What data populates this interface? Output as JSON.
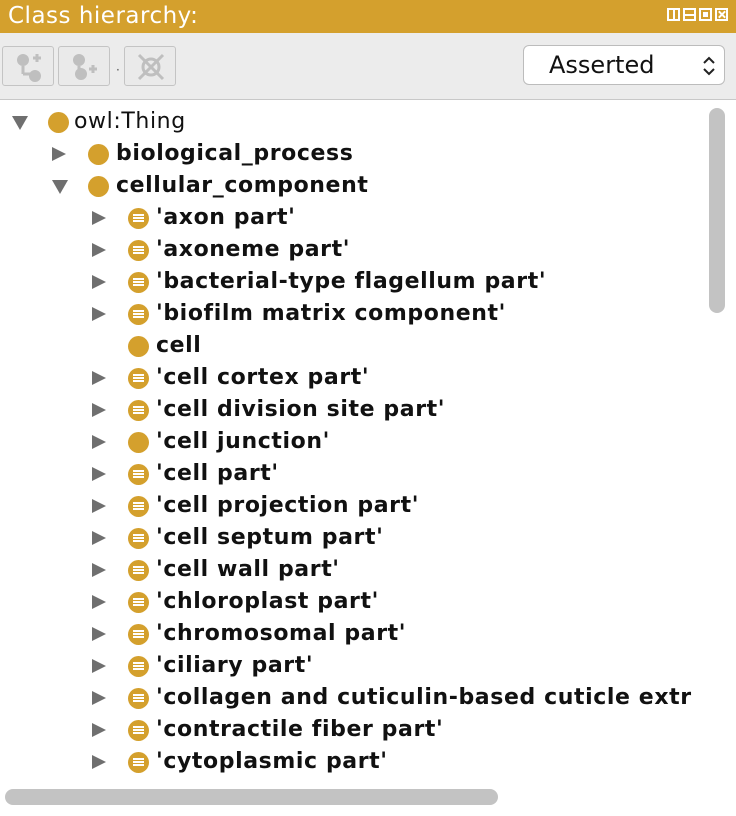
{
  "window": {
    "title": "Class hierarchy:",
    "controls": [
      "split-view-icon",
      "minimize-icon",
      "maximize-icon",
      "close-icon"
    ]
  },
  "toolbar": {
    "buttons": [
      {
        "name": "add-subclass-button",
        "icon": "add-subclass-icon"
      },
      {
        "name": "add-sibling-class-button",
        "icon": "add-sibling-class-icon"
      },
      {
        "name": "delete-class-button",
        "icon": "delete-class-icon"
      }
    ],
    "separator": "·",
    "view_select": {
      "value": "Asserted"
    }
  },
  "tree": {
    "rows": [
      {
        "label": "owl:Thing",
        "toggle": "expanded",
        "icon": "class-icon",
        "bold": false,
        "depth": 0
      },
      {
        "label": "biological_process",
        "toggle": "collapsed",
        "icon": "class-icon",
        "bold": true,
        "depth": 1
      },
      {
        "label": "cellular_component",
        "toggle": "expanded",
        "icon": "class-icon",
        "bold": true,
        "depth": 1
      },
      {
        "label": "'axon part'",
        "toggle": "collapsed",
        "icon": "defined-class-icon",
        "bold": true,
        "depth": 2
      },
      {
        "label": "'axoneme part'",
        "toggle": "collapsed",
        "icon": "defined-class-icon",
        "bold": true,
        "depth": 2
      },
      {
        "label": "'bacterial-type flagellum part'",
        "toggle": "collapsed",
        "icon": "defined-class-icon",
        "bold": true,
        "depth": 2
      },
      {
        "label": "'biofilm matrix component'",
        "toggle": "collapsed",
        "icon": "defined-class-icon",
        "bold": true,
        "depth": 2
      },
      {
        "label": "cell",
        "toggle": "none",
        "icon": "class-icon",
        "bold": true,
        "depth": 2
      },
      {
        "label": "'cell cortex part'",
        "toggle": "collapsed",
        "icon": "defined-class-icon",
        "bold": true,
        "depth": 2
      },
      {
        "label": "'cell division site part'",
        "toggle": "collapsed",
        "icon": "defined-class-icon",
        "bold": true,
        "depth": 2
      },
      {
        "label": "'cell junction'",
        "toggle": "collapsed",
        "icon": "class-icon",
        "bold": true,
        "depth": 2
      },
      {
        "label": "'cell part'",
        "toggle": "collapsed",
        "icon": "defined-class-icon",
        "bold": true,
        "depth": 2
      },
      {
        "label": "'cell projection part'",
        "toggle": "collapsed",
        "icon": "defined-class-icon",
        "bold": true,
        "depth": 2
      },
      {
        "label": "'cell septum part'",
        "toggle": "collapsed",
        "icon": "defined-class-icon",
        "bold": true,
        "depth": 2
      },
      {
        "label": "'cell wall part'",
        "toggle": "collapsed",
        "icon": "defined-class-icon",
        "bold": true,
        "depth": 2
      },
      {
        "label": "'chloroplast part'",
        "toggle": "collapsed",
        "icon": "defined-class-icon",
        "bold": true,
        "depth": 2
      },
      {
        "label": "'chromosomal part'",
        "toggle": "collapsed",
        "icon": "defined-class-icon",
        "bold": true,
        "depth": 2
      },
      {
        "label": "'ciliary part'",
        "toggle": "collapsed",
        "icon": "defined-class-icon",
        "bold": true,
        "depth": 2
      },
      {
        "label": "'collagen and cuticulin-based cuticle extr",
        "toggle": "collapsed",
        "icon": "defined-class-icon",
        "bold": true,
        "depth": 2
      },
      {
        "label": "'contractile fiber part'",
        "toggle": "collapsed",
        "icon": "defined-class-icon",
        "bold": true,
        "depth": 2
      },
      {
        "label": "'cytoplasmic part'",
        "toggle": "collapsed",
        "icon": "defined-class-icon",
        "bold": true,
        "depth": 2
      },
      {
        "label": "",
        "toggle": "collapsed",
        "icon": "defined-class-icon",
        "bold": true,
        "depth": 2
      }
    ]
  },
  "colors": {
    "accent": "#d4a02d",
    "toggle": "#6f6f6f",
    "scrollbar": "#c3c3c3"
  }
}
